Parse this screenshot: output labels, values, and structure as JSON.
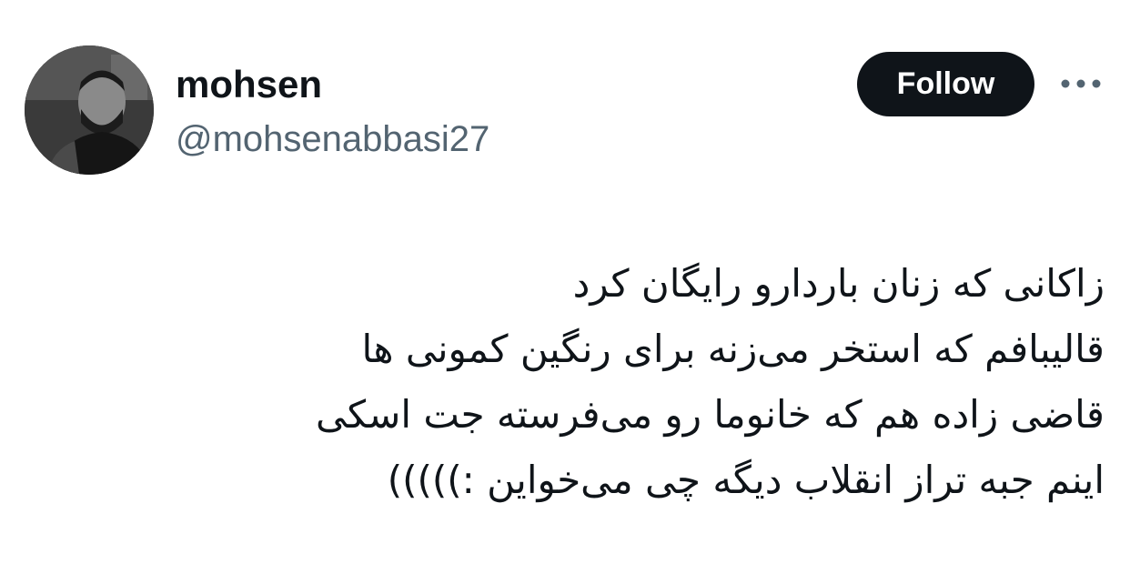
{
  "user": {
    "display_name": "mohsen",
    "handle": "@mohsenabbasi27"
  },
  "actions": {
    "follow_label": "Follow",
    "more_icon": "more-horizontal-icon"
  },
  "tweet": {
    "lines": [
      "زاکانی که زنان باردارو رایگان کرد",
      "قالیبافم که استخر می‌زنه برای رنگین کمونی ها",
      "قاضی زاده هم که خانوما رو می‌فرسته جت اسکی",
      "اینم جبه تراز انقلاب دیگه چی می‌خواین :)))))"
    ]
  },
  "colors": {
    "text_primary": "#0f1419",
    "text_secondary": "#536471",
    "follow_bg": "#0f1419",
    "follow_text": "#ffffff",
    "icon_gray": "#536471"
  }
}
